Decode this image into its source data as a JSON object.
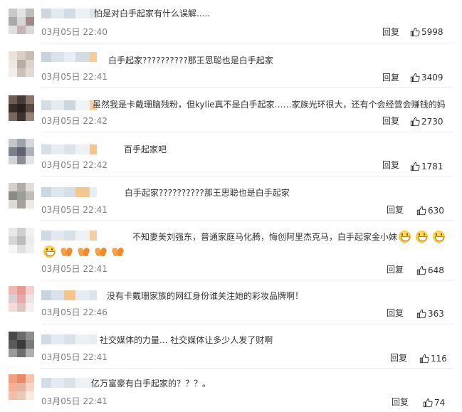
{
  "comments": [
    {
      "text": "怕是对白手起家有什么误解.....",
      "time": "03月05日 22:40",
      "reply": "回复",
      "likes": "5998",
      "avatar": [
        "#c8c8c8",
        "#e3e3e3",
        "#bdbdbd",
        "#a9a9a9",
        "#d6d6d6",
        "#9e8a8a",
        "#e0e0e0",
        "#c4b4b4",
        "#dadada"
      ],
      "name_colors": [
        "#cfd6de",
        "#e4e9ee",
        "#d2dce4",
        "#eef1f4",
        "#dfe5ea"
      ]
    },
    {
      "text": "白手起家??????????那王思聪也是白手起家",
      "time": "03月05日 22:41",
      "reply": "回复",
      "likes": "3409",
      "avatar": [
        "#e9e3dc",
        "#d9cfc4",
        "#c7bdb2",
        "#efe9e3",
        "#b9aea3",
        "#dcd4cc",
        "#f2eeea",
        "#cbc2b8",
        "#e2dbd3"
      ],
      "name_colors": [
        "#c9d3dd",
        "#dbe3ea",
        "#e8eef3",
        "#d3dbe3",
        "#f4cc9c"
      ]
    },
    {
      "text": "虽然我是卡戴珊脑残粉，但kylie真不是白手起家……家族光环很大，还有个会经营会赚钱的妈",
      "time": "03月05日 22:42",
      "reply": "回复",
      "likes": "2730",
      "avatar": [
        "#6e5a52",
        "#4a3a36",
        "#8a7468",
        "#3b2d2a",
        "#2a201e",
        "#5c4a44",
        "#7a6660",
        "#403230",
        "#968276"
      ],
      "name_colors": [
        "#d4dce4",
        "#e6ebf0",
        "#cdd6df",
        "#f1f4f7",
        "#f5d2a6"
      ]
    },
    {
      "text": "百手起家吧",
      "time": "03月05日 22:42",
      "reply": "回复",
      "likes": "1781",
      "avatar": [
        "#c4c6cc",
        "#9ea2aa",
        "#d6d8dc",
        "#7c808a",
        "#5e6270",
        "#aeb2ba",
        "#d0d2d6",
        "#8a8e98",
        "#e2e4e6"
      ],
      "name_colors": [
        "#d6dee6",
        "#e6ecf1",
        "#dce3ea",
        "#eef2f5",
        "#f3c48e"
      ]
    },
    {
      "text": "白手起家??????????那王思聪也是白手起家",
      "time": "03月05日 22:41",
      "reply": "回复",
      "likes": "630",
      "avatar": [
        "#d4d0cc",
        "#b0aca6",
        "#e2deda",
        "#8c8882",
        "#9aa096",
        "#c0bcb6",
        "#dedad6",
        "#a4a09a",
        "#ece8e4"
      ],
      "name_colors": [
        "#cdd7e0",
        "#dfe6ec",
        "#d6dee6",
        "#f0c890",
        "#e9eef2"
      ]
    },
    {
      "text": "不知妻美刘强东，普通家庭马化腾，悔创阿里杰克马，白手起家金小妹",
      "time": "03月05日 22:41",
      "reply": "回复",
      "likes": "648",
      "avatar": [
        "#e8e8e8",
        "#cfcfcf",
        "#f2f2f2",
        "#d6d6d6",
        "#bcbcbc",
        "#ececec",
        "#f6f6f6",
        "#e0e0e0",
        "#f0f0f0"
      ],
      "name_colors": [
        "#d0d9e2",
        "#e3e9ee",
        "#d8e0e7",
        "#eef2f5",
        "#f2cea0"
      ]
    },
    {
      "text": "没有卡戴珊家族的网红身份谁关注她的彩妆品牌啊！",
      "time": "03月05日 22:46",
      "reply": "回复",
      "likes": "363",
      "avatar": [
        "#f0b8b4",
        "#e89a94",
        "#f6d0cc",
        "#d8d0d0",
        "#e8aaa6",
        "#efe4e4",
        "#f4dcd8",
        "#e0c4c0",
        "#faeeec"
      ],
      "name_colors": [
        "#c8d4e0",
        "#d8e2ea",
        "#f3c68c",
        "#e6ecf1",
        "#dde4ea"
      ]
    },
    {
      "text": "社交媒体的力量... 社交媒体让多少人发了财啊",
      "time": "03月05日 22:41",
      "reply": "回复",
      "likes": "116",
      "avatar": [
        "#4a4a4a",
        "#6a6a6a",
        "#8e8e8e",
        "#5a5a5a",
        "#3a3a3a",
        "#7a7a7a",
        "#9a9a9a",
        "#6e6e6e",
        "#b0b0b0"
      ],
      "name_colors": [
        "#d2dae2",
        "#e4eaef",
        "#dae1e8",
        "#edf1f4",
        "#e8edf1"
      ]
    },
    {
      "text": "亿万富豪有白手起家的？？？。",
      "time": "03月05日 22:41",
      "reply": "回复",
      "likes": "74",
      "avatar": [
        "#f0a080",
        "#e88864",
        "#f6c4ac",
        "#f4b090",
        "#e4b4a0",
        "#f8d4c4",
        "#f2c0a8",
        "#eccab8",
        "#faeadf"
      ],
      "name_colors": [
        "#d4dce4",
        "#e5ebf0",
        "#dbe2e9",
        "#eef2f5",
        "#e9eef2"
      ]
    }
  ],
  "row6_emojis": [
    "smile-emoji",
    "smile-emoji",
    "smile-emoji",
    "smile-emoji",
    "clap-emoji",
    "clap-emoji",
    "clap-emoji",
    "clap-emoji"
  ],
  "colors": {
    "time": "#808080",
    "text": "#333333",
    "separator": "#ececec"
  }
}
